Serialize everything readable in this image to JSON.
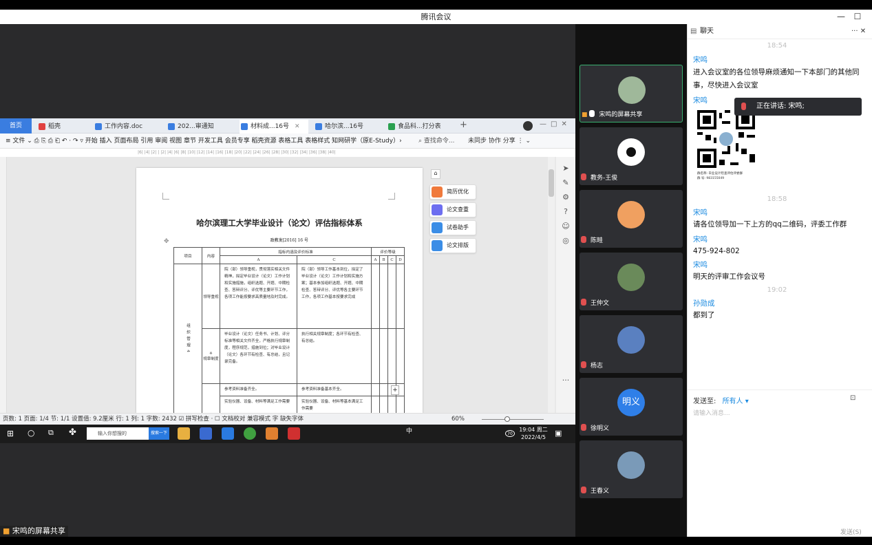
{
  "window": {
    "title": "腾讯会议",
    "minimize": "—",
    "maximize": "☐"
  },
  "share": {
    "label": "宋鸣的屏幕共享"
  },
  "wps": {
    "tabs": [
      {
        "label": "首页"
      },
      {
        "label": "稻壳"
      },
      {
        "label": "工作内容.doc"
      },
      {
        "label": "202...审通知"
      },
      {
        "label": "材料成...16号"
      },
      {
        "label": "哈尔滨...16号"
      },
      {
        "label": "食品科...打分表"
      }
    ],
    "menu": "≡ 文件 ⌄   ⎙ ⎘ ⎙ ⎗ ↶ · ↷ ▿  开始 插入 页面布局 引用 审阅 视图 章节 开发工具 会员专享 稻壳资源  表格工具  表格样式  知网研学（原E-Study）›",
    "search": "查找命令...",
    "right_menu": "未同步  协作  分享  ⋮  ⌄",
    "ruler": "|6| |4| |2| | |2| |4| |6| |8| |10| |12| |14| |16| |18| |20| |22| |24| |26| |28| |30| |32| |34| |36| |38| |40|",
    "doc": {
      "title": "哈尔滨理工大学毕业设计（论文）评估指标体系",
      "number": "政教发[2016] 16 号",
      "headers": {
        "xiangmu": "项目",
        "neirong": "内容",
        "zhibiao": "指标内涵及评价标准",
        "pingjia": "评价等级",
        "a": "A",
        "c": "C",
        "ga": "A",
        "gb": "B",
        "gc": "C",
        "gd": "D"
      },
      "row1": {
        "content": "领导重视",
        "a": "院（部）领导重视，贯彻落实相关文件精神，拟定毕业设计（论文）工作计划和实施措施，组织选题、开题、中期检查、答辩评分、评优等主要环节工作，各项工作能按要求高质量地及时完成。",
        "c": "院（部）领导工作基本到位，拟定了毕业设计（论文）工作计划和实施方案；基本参加组织选题、开题、中期检查、答辩评分、评优等各主要环节工作，各项工作基本按要求完成"
      },
      "row2": {
        "content": "规章制度",
        "star": "※",
        "a": "毕业设计（论文）任务书、计划、评分标准等相关文件齐全，严格执行规章制度，程序规范，措施到位；对毕业设计（论文）各环节有检查、有总结，且记录完备。",
        "c": "执行相关规章制度；各环节有检查、有总结。"
      },
      "row3": {
        "xiangmu": "组织管理4",
        "a": "参考资料准备齐全。",
        "c": "参考资料准备基本齐全。"
      },
      "row4": {
        "a": "实验仪器、设备、材料等满足工作需要",
        "c": "实验仪器、设备、材料等基本满足工作需要"
      }
    },
    "side": [
      {
        "label": "简历优化",
        "color": "#f07a3c"
      },
      {
        "label": "论文查重",
        "color": "#6d6ef0"
      },
      {
        "label": "试卷助手",
        "color": "#3b8de6"
      },
      {
        "label": "论文排版",
        "color": "#3b8de6"
      }
    ],
    "status": "页数: 1   页面: 1/4   节: 1/1   设置值: 9.2厘米   行: 1   列: 1     字数: 2432   ☑ 拼写检查 ·   ☐ 文档校对     兼容模式   字 缺失字体",
    "zoom": "60%"
  },
  "taskbar": {
    "search": "输入你想搜的",
    "search_btn": "搜索一下",
    "ime": "中",
    "temp": "70",
    "time": "19:04 周二",
    "date": "2022/4/5"
  },
  "participants": [
    {
      "name": "宋鸣的屏幕共享",
      "color": "#9fb89a"
    },
    {
      "name": "教务-王俊",
      "color": "#ffffff"
    },
    {
      "name": "陈畦",
      "color": "#f0a060"
    },
    {
      "name": "王仲文",
      "color": "#6a8a5a"
    },
    {
      "name": "杨志",
      "color": "#5a80c0"
    },
    {
      "name": "徐明义",
      "color": "#2f7fe8",
      "initials": "明义"
    },
    {
      "name": "王春义",
      "color": "#7a9ab8"
    }
  ],
  "chat": {
    "header": "聊天",
    "header_icons": "··· ✕",
    "time1": "18:54",
    "sender1": "宋鸣",
    "msg1": "进入会议室的各位领导麻烦通知一下本部门的其他同事，尽快进入会议室",
    "sender2": "宋鸣",
    "qr_caption": "群名称: 毕业设计检查评估评委群\n群  号: 983155049",
    "time2": "18:58",
    "sender3": "宋鸣",
    "msg3": "请各位领导加一下上方的qq二维码，评委工作群",
    "sender4": "宋鸣",
    "msg4": "475-924-802",
    "sender5": "宋鸣",
    "msg5": "明天的评审工作会议号",
    "time3": "19:02",
    "sender6": "孙勋成",
    "msg6": "都到了",
    "send_to_label": "发送至:",
    "send_to_value": "所有人 ▾",
    "placeholder": "请输入消息...",
    "send_button": "发送(S)"
  },
  "speaking": "正在讲话: 宋鸣;"
}
